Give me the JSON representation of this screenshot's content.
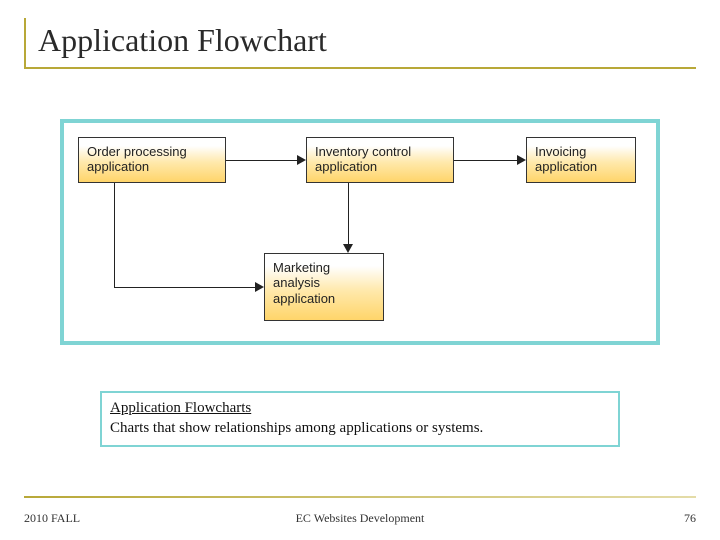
{
  "title": "Application Flowchart",
  "nodes": {
    "n1": "Order processing application",
    "n2": "Inventory control application",
    "n3": "Invoicing application",
    "n4": "Marketing analysis application"
  },
  "caption": {
    "heading": "Application Flowcharts",
    "body": "Charts that show relationships among applications or systems."
  },
  "footer": {
    "left": "2010 FALL",
    "center": "EC Websites Development",
    "right": "76"
  }
}
